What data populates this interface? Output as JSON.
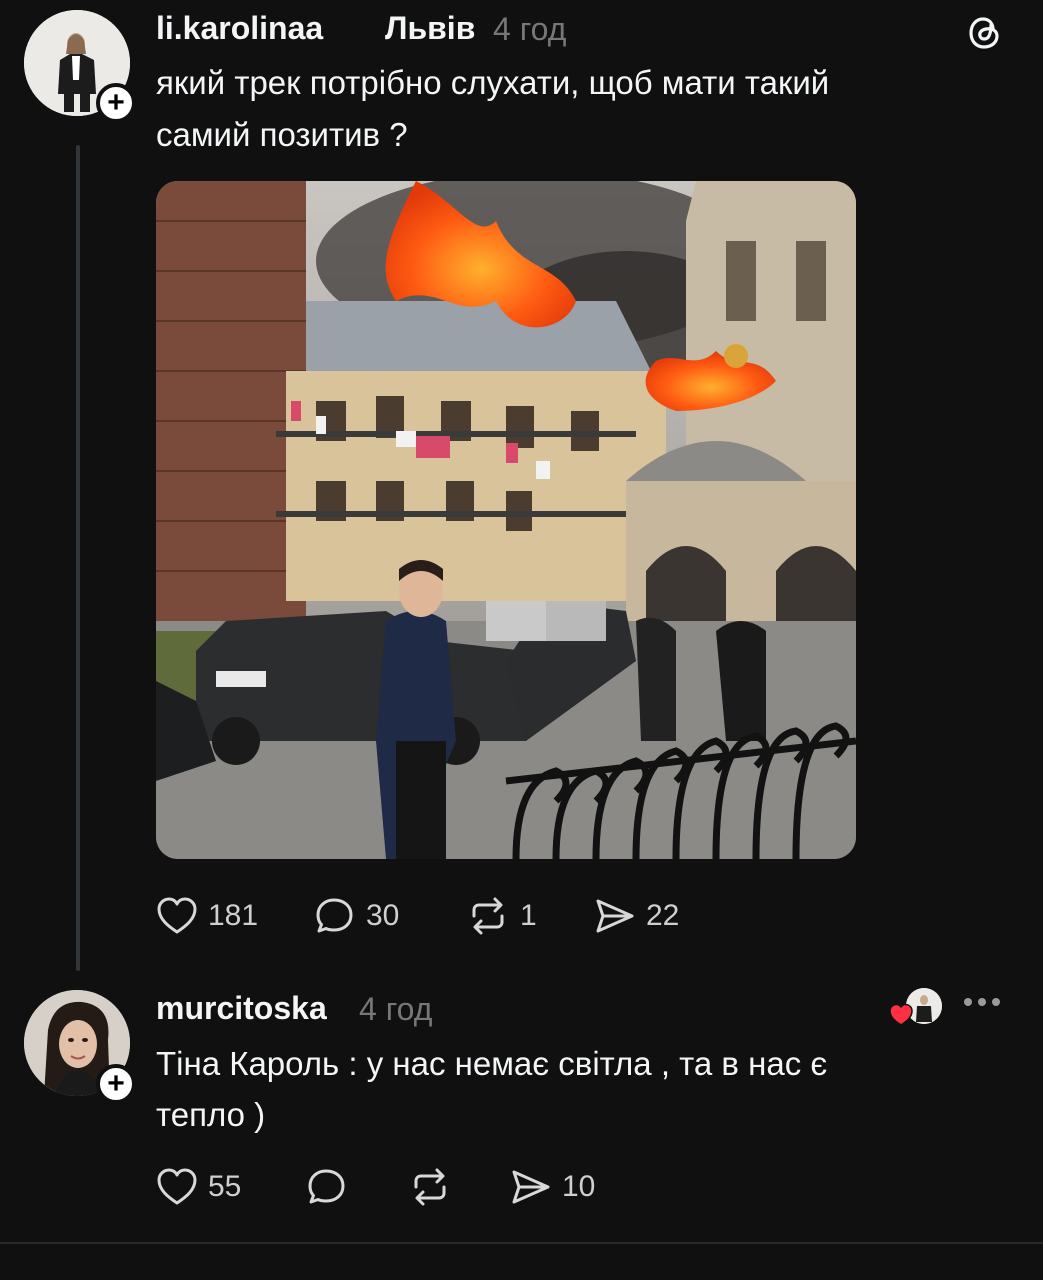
{
  "app": {
    "brand_icon": "threads-logo-icon"
  },
  "post": {
    "username": "li.karolinaa",
    "location": "Львів",
    "time": "4 год",
    "text_line1": "який трек потрібно слухати, щоб мати такий",
    "text_line2": "самий позитив ?",
    "image_subject": "photo: man in headphones smiling on street while building with church tower burns behind",
    "likes": "181",
    "replies": "30",
    "reposts": "1",
    "shares": "22"
  },
  "reply": {
    "username": "murcitoska",
    "time": "4 год",
    "text_line1": "Тіна Кароль : у нас немає світла , та в нас є",
    "text_line2": "тепло )",
    "likes": "55",
    "shares": "10"
  },
  "colors": {
    "background": "#101010",
    "text": "#f3f5f7",
    "muted": "#777777",
    "heart": "#ff3040"
  }
}
